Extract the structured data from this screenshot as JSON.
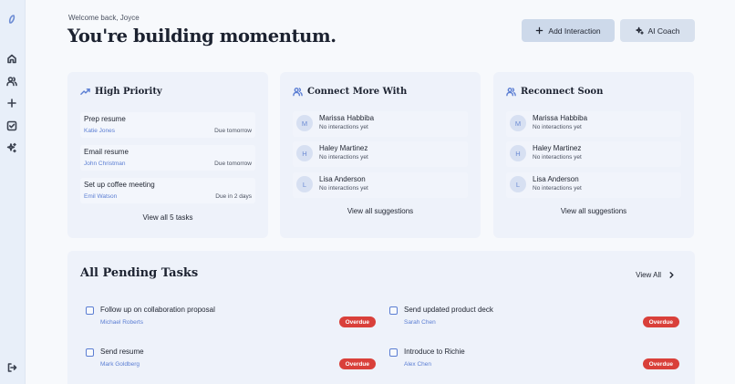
{
  "header": {
    "welcome": "Welcome back, Joyce",
    "headline": "You're building momentum.",
    "add_interaction_label": "Add Interaction",
    "ai_coach_label": "AI Coach"
  },
  "sidebar": {
    "items": [
      {
        "icon": "logo-icon"
      },
      {
        "icon": "home-icon"
      },
      {
        "icon": "users-icon"
      },
      {
        "icon": "plus-icon"
      },
      {
        "icon": "checklist-icon"
      },
      {
        "icon": "sparkle-icon"
      },
      {
        "icon": "logout-icon"
      }
    ]
  },
  "high_priority": {
    "title": "High Priority",
    "tasks": [
      {
        "title": "Prep resume",
        "person": "Katie Jones",
        "due": "Due tomorrow"
      },
      {
        "title": "Email resume",
        "person": "John Christman",
        "due": "Due tomorrow"
      },
      {
        "title": "Set up coffee meeting",
        "person": "Emil Watson",
        "due": "Due in 2 days"
      }
    ],
    "view_all": "View all 5 tasks"
  },
  "connect_more": {
    "title": "Connect More With",
    "people": [
      {
        "initial": "M",
        "name": "Marissa Habbiba",
        "status": "No interactions yet"
      },
      {
        "initial": "H",
        "name": "Haley Martinez",
        "status": "No interactions yet"
      },
      {
        "initial": "L",
        "name": "Lisa Anderson",
        "status": "No interactions yet"
      }
    ],
    "view_all": "View all suggestions"
  },
  "reconnect": {
    "title": "Reconnect Soon",
    "people": [
      {
        "initial": "M",
        "name": "Marissa Habbiba",
        "status": "No interactions yet"
      },
      {
        "initial": "H",
        "name": "Haley Martinez",
        "status": "No interactions yet"
      },
      {
        "initial": "L",
        "name": "Lisa Anderson",
        "status": "No interactions yet"
      }
    ],
    "view_all": "View all suggestions"
  },
  "pending": {
    "title": "All Pending Tasks",
    "view_all": "View All",
    "tasks": [
      {
        "title": "Follow up on collaboration proposal",
        "person": "Michael Roberts",
        "badge": "Overdue"
      },
      {
        "title": "Send updated product deck",
        "person": "Sarah Chen",
        "badge": "Overdue"
      },
      {
        "title": "Send resume",
        "person": "Mark Goldberg",
        "badge": "Overdue"
      },
      {
        "title": "Introduce to Richie",
        "person": "Alex Chen",
        "badge": "Overdue"
      }
    ]
  },
  "colors": {
    "accent": "#5b7ed3",
    "overdue": "#d9403a",
    "card_bg": "#eef2fa",
    "button_bg": "#cdd9ea"
  }
}
